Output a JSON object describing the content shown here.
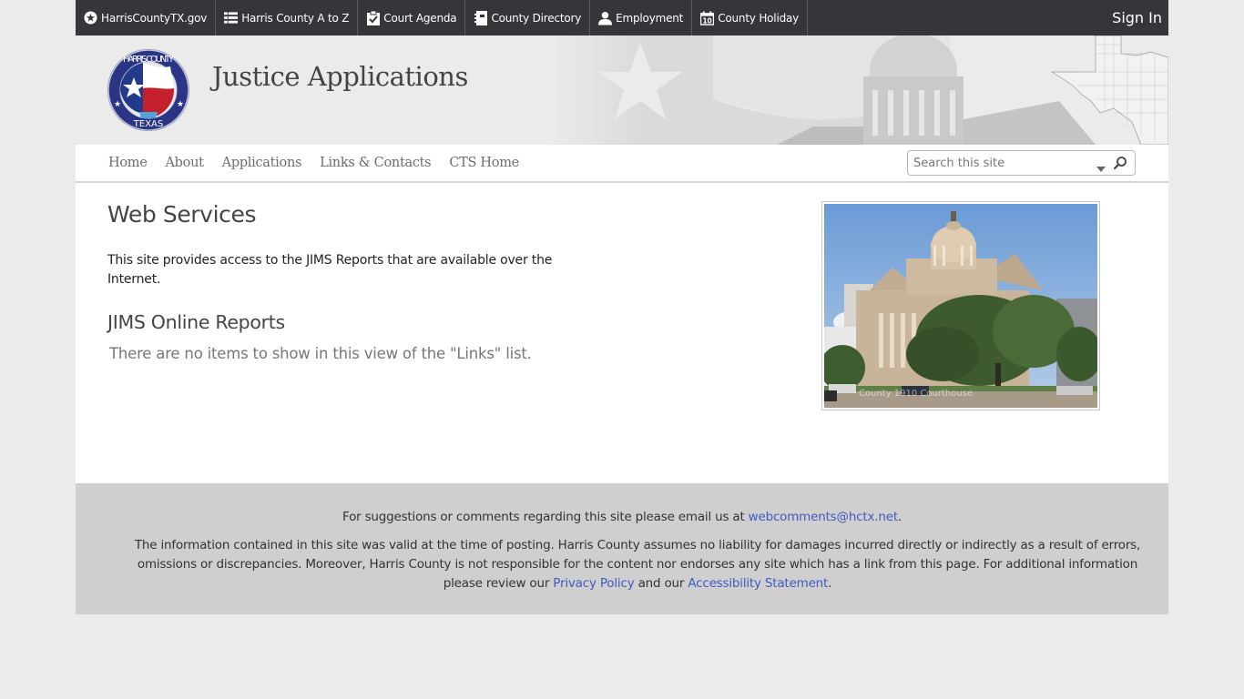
{
  "topbar": {
    "items": [
      {
        "label": "HarrisCountyTX.gov",
        "icon": "star-circle-icon"
      },
      {
        "label": "Harris County A to Z",
        "icon": "list-icon"
      },
      {
        "label": "Court Agenda",
        "icon": "clipboard-check-icon"
      },
      {
        "label": "County Directory",
        "icon": "address-book-icon"
      },
      {
        "label": "Employment",
        "icon": "user-icon"
      },
      {
        "label": "County Holiday",
        "icon": "calendar-icon",
        "icon_text": "10"
      }
    ],
    "signin_label": "Sign In"
  },
  "banner": {
    "site_title": "Justice Applications",
    "logo": {
      "top_text": "HARRIS COUNTY",
      "bottom_text": "TEXAS"
    }
  },
  "nav": {
    "items": [
      {
        "label": "Home"
      },
      {
        "label": "About"
      },
      {
        "label": "Applications"
      },
      {
        "label": "Links & Contacts"
      },
      {
        "label": "CTS Home"
      }
    ],
    "search": {
      "placeholder": "Search this site",
      "value": ""
    }
  },
  "main": {
    "title": "Web Services",
    "intro": "This site provides access to the JIMS Reports that are available over the Internet.",
    "section_title": "JIMS Online Reports",
    "empty_message": "There are no items to show in this view of the \"Links\" list.",
    "photo_caption": "County 1910 Courthouse"
  },
  "footer": {
    "suggestion_text": "For suggestions or comments regarding this site please email us at ",
    "email": "webcomments@hctx.net",
    "period": ".",
    "disclaimer": "The information contained in this site was valid at the time of posting. Harris County assumes no liability for damages incurred directly or indirectly as a result of errors, omissions or discrepancies. Moreover, Harris County is not responsible for the content nor endorses any site which has a link from this page. For additional information please review our ",
    "privacy_link": "Privacy Policy",
    "and_our": " and our ",
    "accessibility_link": "Accessibility Statement",
    "end": "."
  },
  "colors": {
    "topbar_bg": "#36353a",
    "footer_bg": "#cfcfcf",
    "link": "#3d5bc2",
    "page_bg": "#ebebeb"
  }
}
